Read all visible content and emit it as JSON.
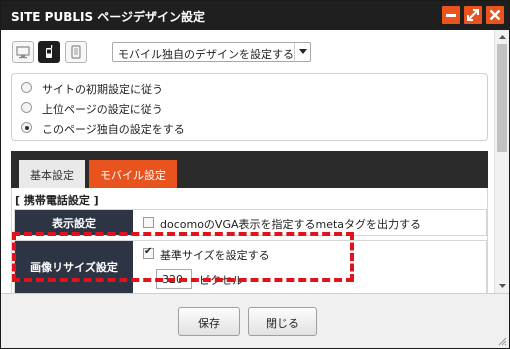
{
  "window": {
    "title": "SITE PUBLIS ページデザイン設定",
    "accent_color": "#e8531e",
    "controls": [
      "minimize-icon",
      "maximize-icon",
      "close-icon"
    ]
  },
  "devices": {
    "items": [
      {
        "name": "pc-icon",
        "selected": false
      },
      {
        "name": "mobile-icon",
        "selected": true
      },
      {
        "name": "tablet-icon",
        "selected": false
      }
    ],
    "select_value": "モバイル独自のデザインを設定する"
  },
  "radio_group": {
    "options": [
      {
        "label": "サイトの初期設定に従う",
        "checked": false
      },
      {
        "label": "上位ページの設定に従う",
        "checked": false
      },
      {
        "label": "このページ独自の設定をする",
        "checked": true
      }
    ]
  },
  "tabs": [
    {
      "label": "基本設定",
      "active": false
    },
    {
      "label": "モバイル設定",
      "active": true
    }
  ],
  "section": {
    "title": "[ 携帯電話設定 ]",
    "rows": [
      {
        "header": "表示設定",
        "checkbox_label": "docomoのVGA表示を指定するmetaタグを出力する",
        "checked": false
      },
      {
        "header": "画像リサイズ設定",
        "checkbox_label": "基準サイズを設定する",
        "checked": true,
        "input_value": "320",
        "unit": "ピクセル"
      }
    ]
  },
  "highlight_color": "#e0121b",
  "footer": {
    "save_label": "保存",
    "close_label": "閉じる"
  }
}
